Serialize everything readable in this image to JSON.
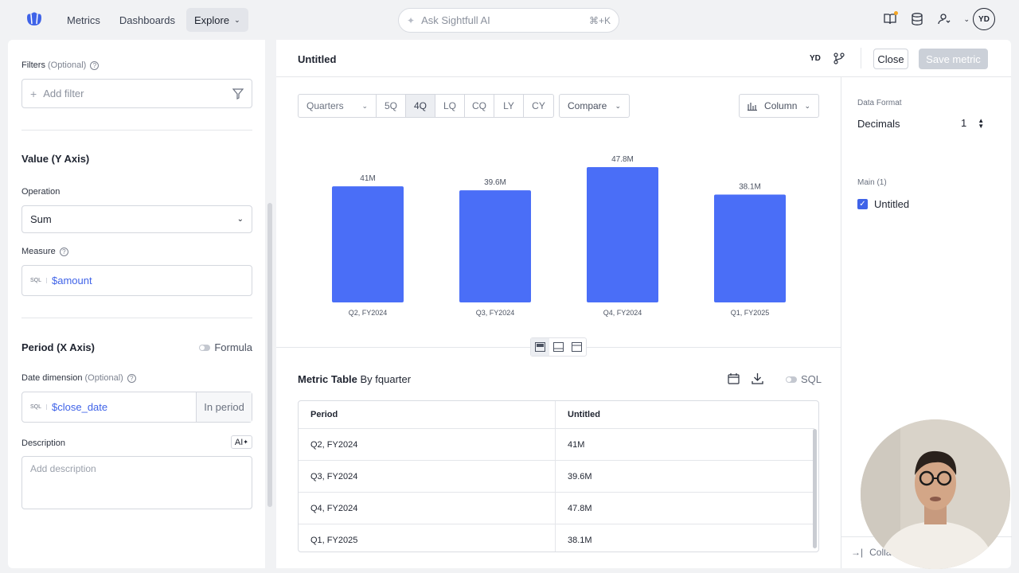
{
  "nav": {
    "items": [
      "Metrics",
      "Dashboards",
      "Explore"
    ]
  },
  "search": {
    "placeholder": "Ask Sightfull AI",
    "shortcut": "⌘+K"
  },
  "user": {
    "initials": "YD"
  },
  "left": {
    "filters_label": "Filters",
    "filters_optional": "(Optional)",
    "add_filter": "Add filter",
    "value_header": "Value (Y Axis)",
    "operation_label": "Operation",
    "operation_value": "Sum",
    "measure_label": "Measure",
    "sql_tag": "SQL",
    "measure_value": "$amount",
    "period_header": "Period (X Axis)",
    "formula_label": "Formula",
    "date_dim_label": "Date dimension",
    "date_dim_optional": "(Optional)",
    "date_dim_value": "$close_date",
    "in_period": "In period",
    "description_label": "Description",
    "ai_button": "AI",
    "description_placeholder": "Add description"
  },
  "main": {
    "title": "Untitled",
    "user_initials": "YD",
    "close": "Close",
    "save": "Save metric",
    "period_dropdown": "Quarters",
    "periods": [
      "5Q",
      "4Q",
      "LQ",
      "CQ",
      "LY",
      "CY"
    ],
    "active_period": "4Q",
    "compare": "Compare",
    "chart_type_button": "Column",
    "table_title": "Metric Table",
    "table_by": "By fquarter",
    "sql_toggle": "SQL",
    "table_headers": [
      "Period",
      "Untitled"
    ],
    "table_rows": [
      [
        "Q2, FY2024",
        "41M"
      ],
      [
        "Q3, FY2024",
        "39.6M"
      ],
      [
        "Q4, FY2024",
        "47.8M"
      ],
      [
        "Q1, FY2025",
        "38.1M"
      ]
    ]
  },
  "right": {
    "data_format": "Data Format",
    "decimals_label": "Decimals",
    "decimals_value": "1",
    "main_group": "Main (1)",
    "series_name": "Untitled",
    "collapse": "Colla"
  },
  "colors": {
    "bar": "#4a6ef7",
    "accent": "#3f63e8"
  },
  "chart_data": {
    "type": "bar",
    "categories": [
      "Q2, FY2024",
      "Q3, FY2024",
      "Q4, FY2024",
      "Q1, FY2025"
    ],
    "values": [
      41,
      39.6,
      47.8,
      38.1
    ],
    "labels": [
      "41M",
      "39.6M",
      "47.8M",
      "38.1M"
    ],
    "title": "",
    "xlabel": "",
    "ylabel": "",
    "ylim": [
      0,
      47.8
    ],
    "grid": false
  }
}
